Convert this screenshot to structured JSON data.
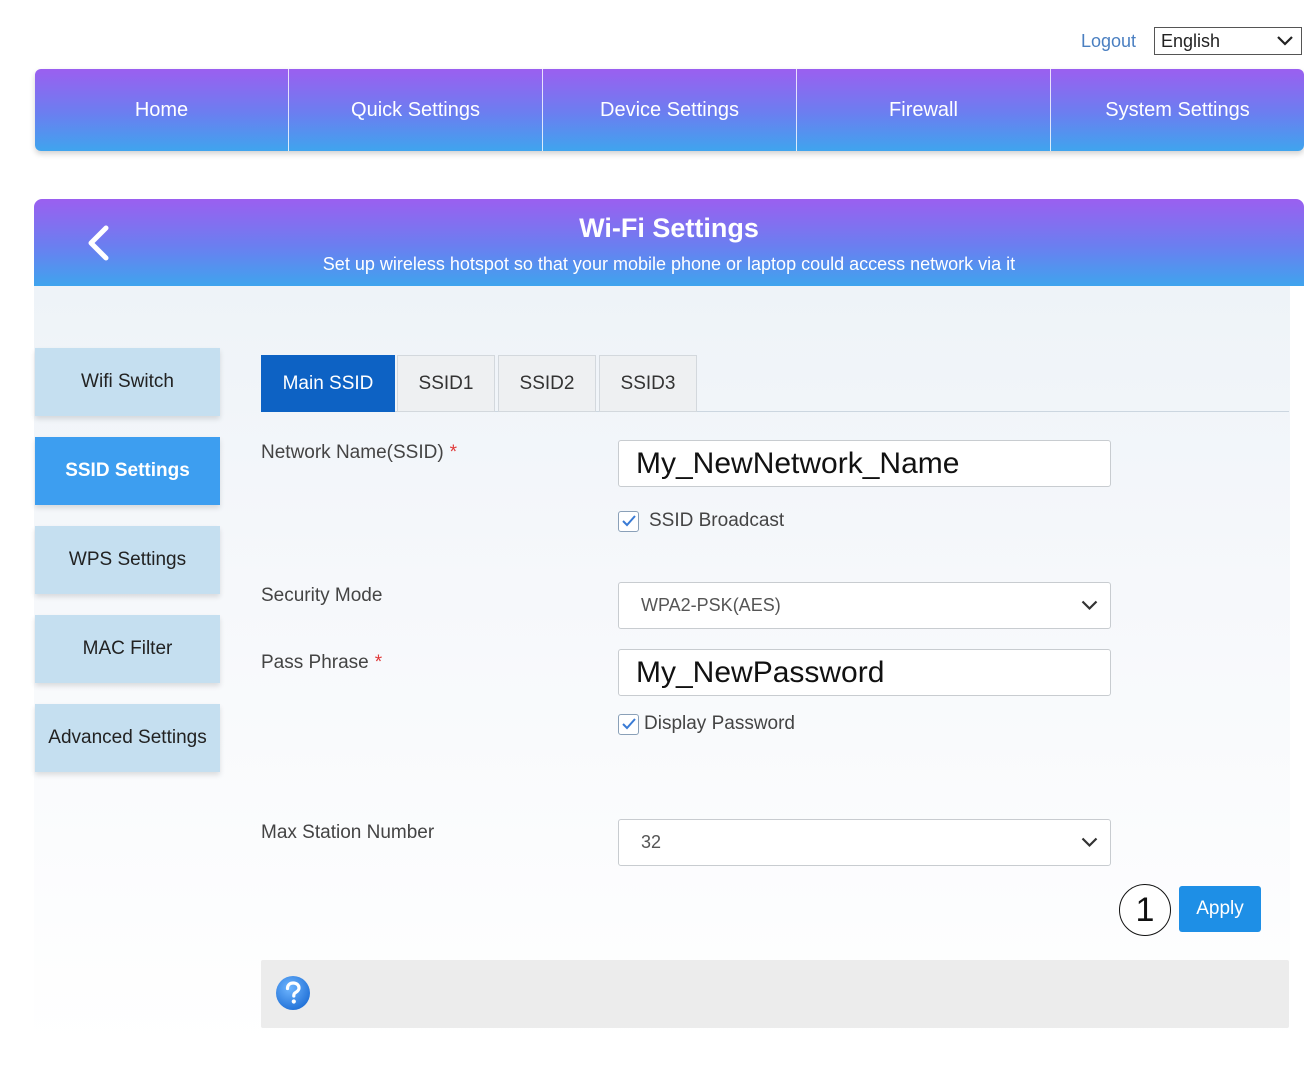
{
  "header": {
    "logout_label": "Logout",
    "language": "English"
  },
  "nav": {
    "items": [
      "Home",
      "Quick Settings",
      "Device Settings",
      "Firewall",
      "System Settings"
    ]
  },
  "banner": {
    "title": "Wi-Fi Settings",
    "subtitle": "Set up wireless hotspot so that your mobile phone or laptop could access network via it"
  },
  "sidebar": {
    "items": [
      {
        "label": "Wifi Switch",
        "active": false
      },
      {
        "label": "SSID Settings",
        "active": true
      },
      {
        "label": "WPS Settings",
        "active": false
      },
      {
        "label": "MAC Filter",
        "active": false
      },
      {
        "label": "Advanced Settings",
        "active": false
      }
    ]
  },
  "tabs": {
    "items": [
      "Main SSID",
      "SSID1",
      "SSID2",
      "SSID3"
    ],
    "active": "Main SSID"
  },
  "form": {
    "network_name_label": "Network Name(SSID)",
    "network_name_value": "My_NewNetwork_Name",
    "required_mark": "*",
    "ssid_broadcast_label": "SSID Broadcast",
    "ssid_broadcast_checked": true,
    "security_mode_label": "Security Mode",
    "security_mode_value": "WPA2-PSK(AES)",
    "pass_phrase_label": "Pass Phrase",
    "pass_phrase_value": "My_NewPassword",
    "display_password_label": "Display Password",
    "display_password_checked": true,
    "max_station_label": "Max Station Number",
    "max_station_value": "32"
  },
  "actions": {
    "step_marker": "1",
    "apply_label": "Apply"
  },
  "help": {
    "icon": "question-circle-icon"
  },
  "colors": {
    "gradient_top": "#9b5ff0",
    "gradient_bottom": "#3fa4ee",
    "active_tab": "#0d62c4",
    "active_sidebar": "#3d9ef0",
    "apply_button": "#1e8fe6",
    "logout_link": "#4a7fc1"
  }
}
